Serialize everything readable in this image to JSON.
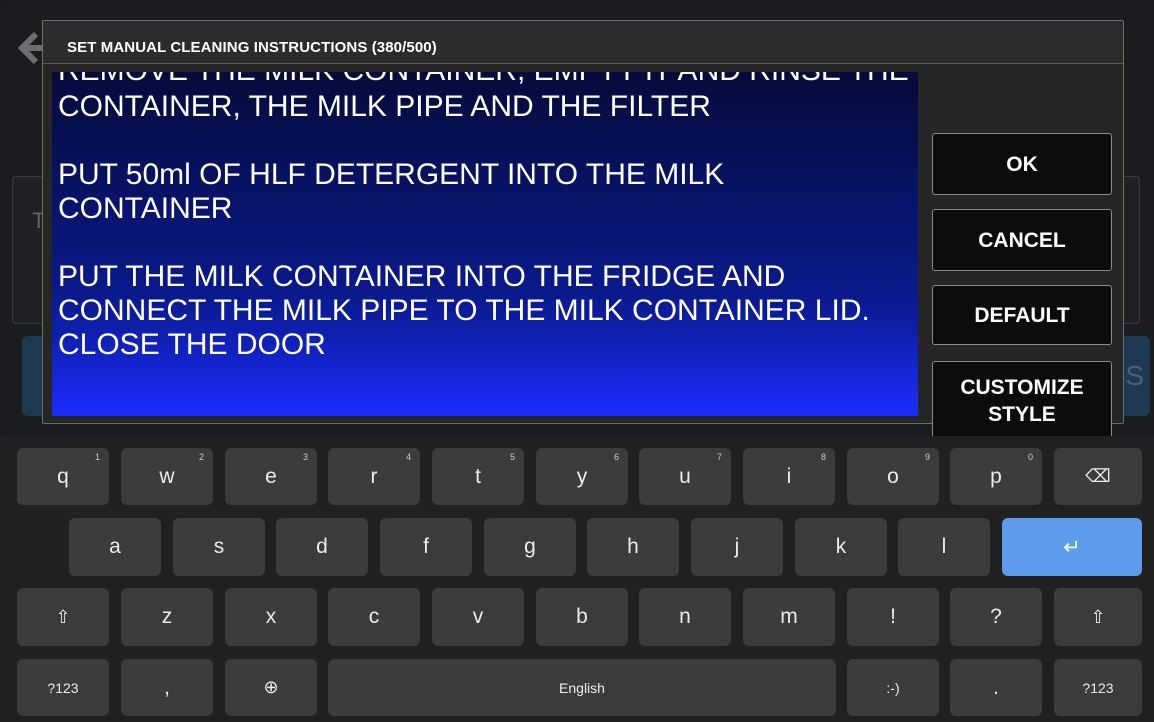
{
  "background_app": {
    "back_icon": "arrow-left-icon",
    "panel_letter": "T",
    "bar_right_letter": "S"
  },
  "dialog": {
    "title": "SET MANUAL CLEANING INSTRUCTIONS (380/500)",
    "clipped_line": "REMOVE THE MILK CONTAINER, EMPTY IT AND RINSE THE",
    "instructions_text": "CONTAINER, THE MILK PIPE AND THE FILTER\n\nPUT 50ml OF HLF DETERGENT INTO THE MILK\nCONTAINER\n\nPUT THE MILK CONTAINER INTO THE FRIDGE AND\nCONNECT THE MILK PIPE TO THE MILK CONTAINER LID.\nCLOSE THE DOOR",
    "buttons": {
      "ok": "OK",
      "cancel": "CANCEL",
      "default": "DEFAULT",
      "customize": "CUSTOMIZE\nSTYLE"
    }
  },
  "keyboard": {
    "row1": [
      {
        "label": "q",
        "hint": "1"
      },
      {
        "label": "w",
        "hint": "2"
      },
      {
        "label": "e",
        "hint": "3"
      },
      {
        "label": "r",
        "hint": "4"
      },
      {
        "label": "t",
        "hint": "5"
      },
      {
        "label": "y",
        "hint": "6"
      },
      {
        "label": "u",
        "hint": "7"
      },
      {
        "label": "i",
        "hint": "8"
      },
      {
        "label": "o",
        "hint": "9"
      },
      {
        "label": "p",
        "hint": "0"
      }
    ],
    "backspace": "⌫",
    "row2": [
      "a",
      "s",
      "d",
      "f",
      "g",
      "h",
      "j",
      "k",
      "l"
    ],
    "enter": "↵",
    "shift": "⇧",
    "row3": [
      "z",
      "x",
      "c",
      "v",
      "b",
      "n",
      "m",
      "!",
      "?"
    ],
    "symbols": "?123",
    "comma": ",",
    "globe": "⊕",
    "space": "English",
    "emoticon": ":-)",
    "period": "."
  },
  "colors": {
    "enter_key": "#5d9cec",
    "text_area_top": "#060b3a",
    "text_area_bottom": "#1a2cff"
  }
}
